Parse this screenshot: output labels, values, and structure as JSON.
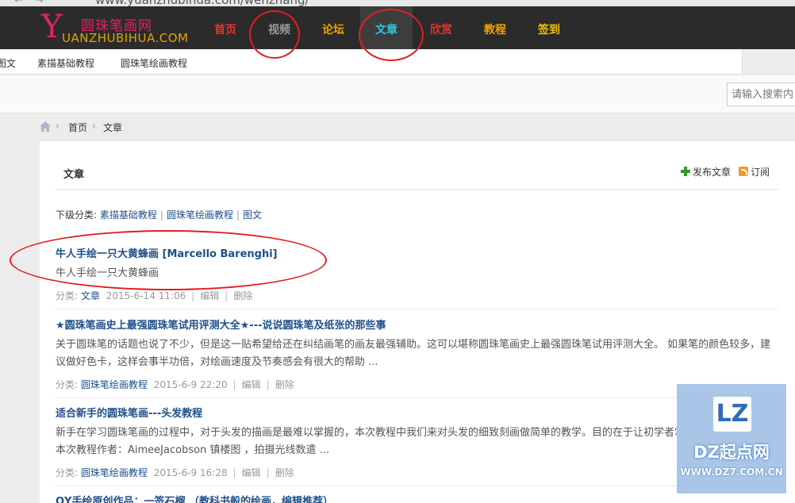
{
  "browser": {
    "url": "www.yuanzhubihua.com/wenzhang/",
    "back": "←",
    "forward": "→"
  },
  "logo": {
    "initial": "Y",
    "cn": "圆珠笔画网",
    "en": "UANZHUBIHUA.COM"
  },
  "nav": [
    {
      "label": "首页",
      "color": "#e5322d"
    },
    {
      "label": "视频",
      "color": "#9a9a9a"
    },
    {
      "label": "论坛",
      "color": "#f0a000"
    },
    {
      "label": "文章",
      "color": "#2ec8e0"
    },
    {
      "label": "欣赏",
      "color": "#e5322d"
    },
    {
      "label": "教程",
      "color": "#f0a000"
    },
    {
      "label": "签到",
      "color": "#f0c000"
    }
  ],
  "subnav": [
    "图文",
    "素描基础教程",
    "圆珠笔绘画教程"
  ],
  "search": {
    "placeholder": "请输入搜索内"
  },
  "breadcrumb": {
    "home": "首页",
    "current": "文章",
    "separator": "›"
  },
  "panel": {
    "title": "文章",
    "publish_label": "发布文章",
    "subscribe_label": "订阅",
    "subcat_prefix": "下级分类:",
    "subcats": [
      "素描基础教程",
      "圆珠笔绘画教程",
      "图文"
    ]
  },
  "articles": [
    {
      "title": "牛人手绘一只大黄蜂画 [Marcello Barenghi]",
      "summary": "牛人手绘一只大黄蜂画",
      "cat_prefix": "分类:",
      "category": "文章",
      "date": "2015-6-14 11:06",
      "edit": "编辑",
      "delete": "删除"
    },
    {
      "title": "★圆珠笔画史上最强圆珠笔试用评测大全★---说说圆珠笔及纸张的那些事",
      "summary": "关于圆珠笔的话题也说了不少，但是这一贴希望给还在纠结画笔的画友最强辅助。这可以堪称圆珠笔画史上最强圆珠笔试用评测大全。 如果笔的颜色较多，建议做好色卡，这样会事半功倍，对绘画速度及节奏感会有很大的帮助 ...",
      "cat_prefix": "分类:",
      "category": "圆珠笔绘画教程",
      "date": "2015-6-9 22:20",
      "edit": "编辑",
      "delete": "删除"
    },
    {
      "title": "适合新手的圆珠笔画---头发教程",
      "summary": "新手在学习圆珠笔画的过程中，对于头发的描画是最难以掌握的，本次教程中我们来对头发的细致刻画做简单的教学。目的在于让初学者掌握头发线条的控制。本次教程作者：AimeeJacobson 镇楼图 ，拍摄光线数遣 ...",
      "cat_prefix": "分类:",
      "category": "圆珠笔绘画教程",
      "date": "2015-6-9 16:28",
      "edit": "编辑",
      "delete": "删除"
    },
    {
      "title": "QY手绘原创作品：一签石榴 （教科书般的绘画，编辑推荐）"
    }
  ],
  "watermark": {
    "mark": "LZ",
    "name": "DZ起点网",
    "url": "WWW.DZ7.COM.CN"
  },
  "colors": {
    "nav_bg": "#2b2b2b",
    "link": "#1f4f8a",
    "annotation": "#e02020",
    "watermark_bg": "#a9c6e8"
  }
}
